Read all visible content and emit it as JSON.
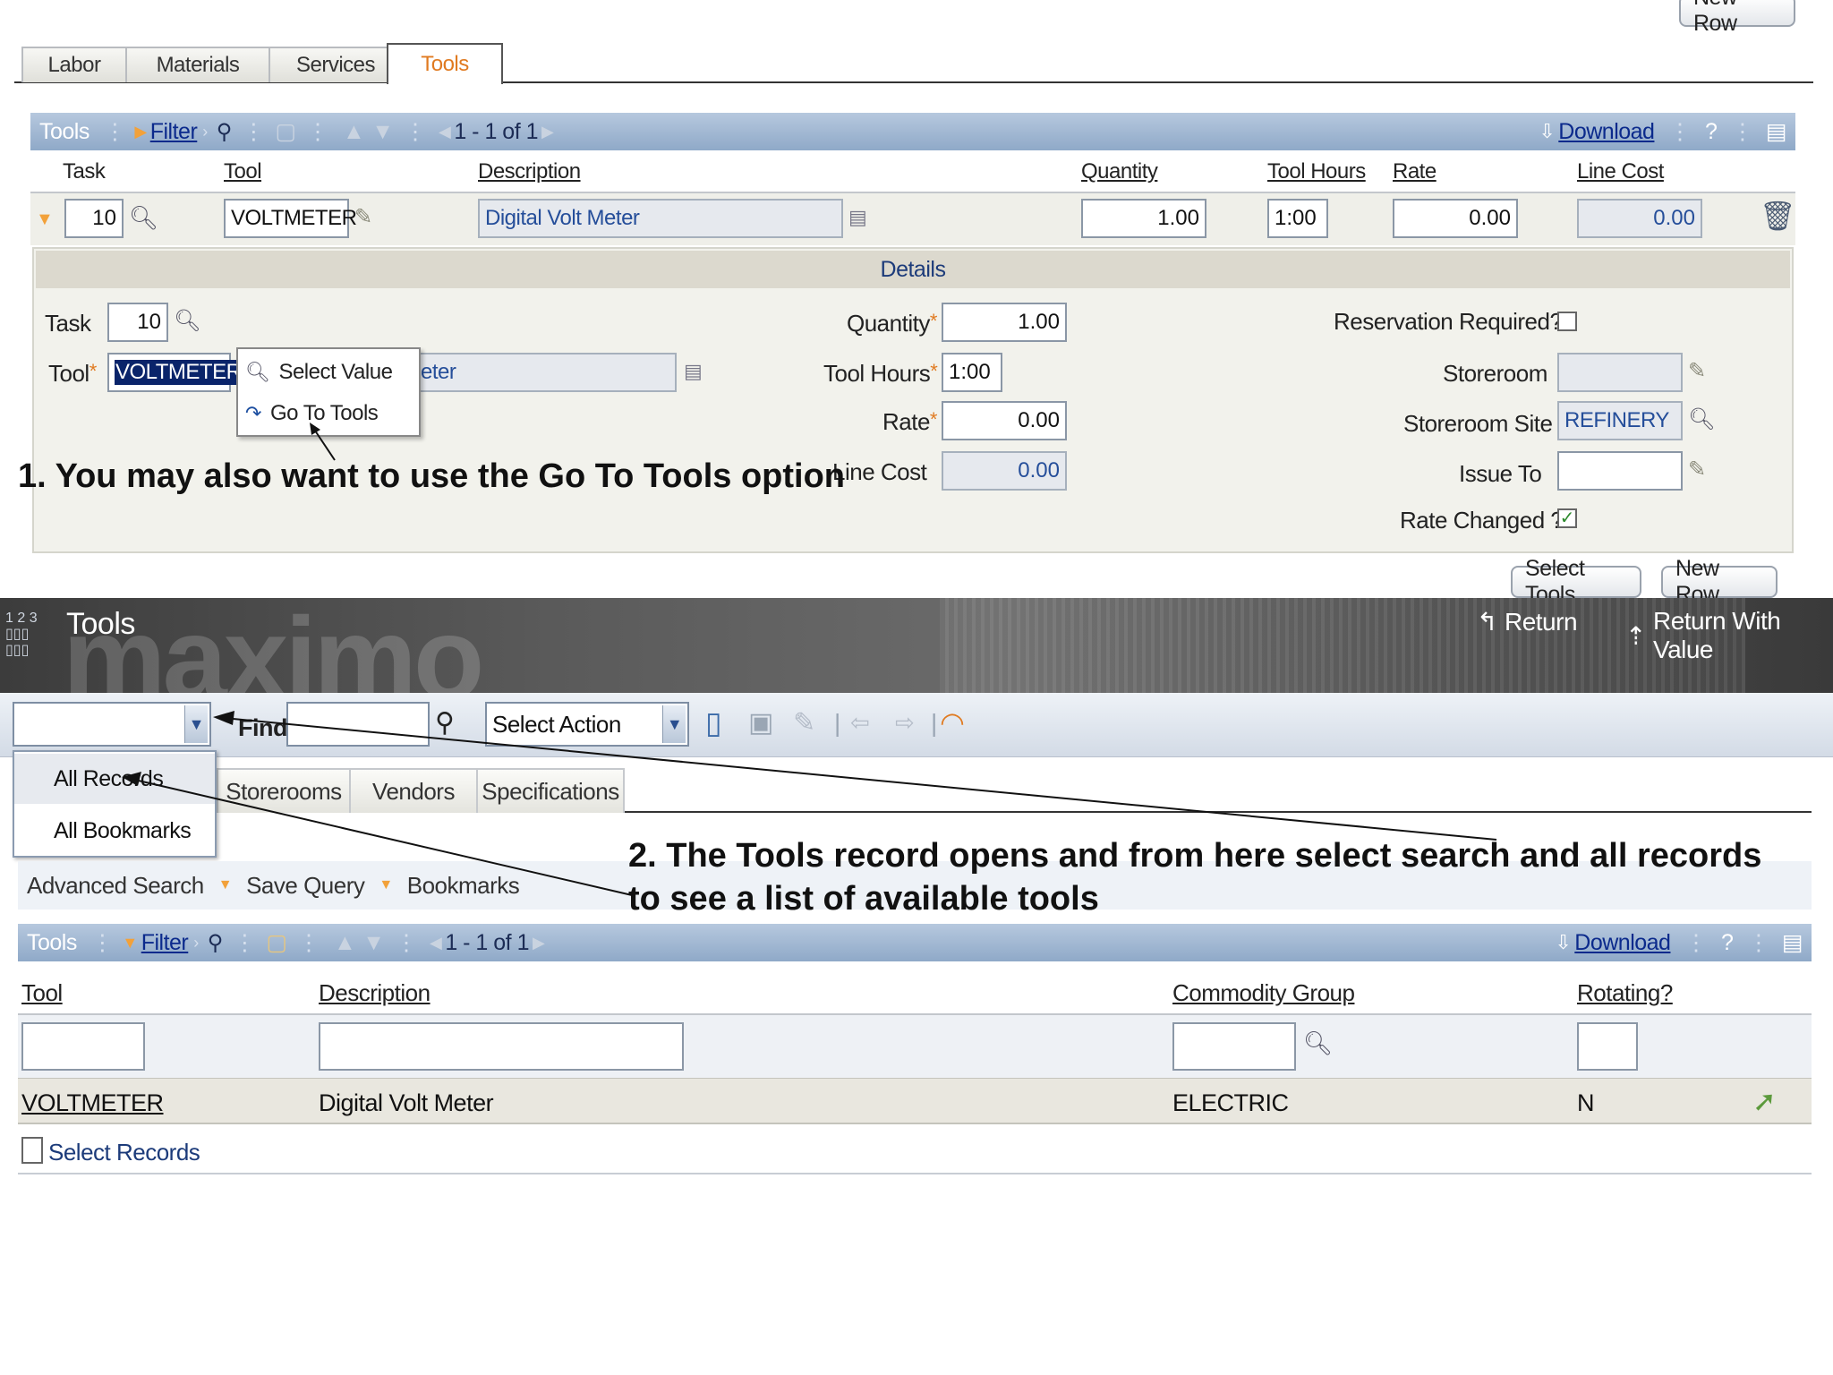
{
  "top": {
    "new_row_top": "New Row",
    "tabs": [
      "Labor",
      "Materials",
      "Services",
      "Tools"
    ],
    "bar": {
      "title": "Tools",
      "filter": "Filter",
      "paging": "1 - 1 of 1",
      "download": "Download",
      "help": "?"
    },
    "columns": [
      "Task",
      "Tool",
      "Description",
      "Quantity",
      "Tool Hours",
      "Rate",
      "Line Cost"
    ],
    "row": {
      "task": "10",
      "tool": "VOLTMETER",
      "description": "Digital Volt Meter",
      "quantity": "1.00",
      "tool_hours": "1:00",
      "rate": "0.00",
      "line_cost": "0.00"
    },
    "details": {
      "heading": "Details",
      "task_label": "Task",
      "task_value": "10",
      "tool_label": "Tool",
      "tool_value": "VOLTMETER",
      "desc_partial": "eter",
      "quantity_label": "Quantity",
      "quantity_value": "1.00",
      "tool_hours_label": "Tool Hours",
      "tool_hours_value": "1:00",
      "rate_label": "Rate",
      "rate_value": "0.00",
      "line_cost_label": "Line Cost",
      "line_cost_value": "0.00",
      "reservation_label": "Reservation Required?",
      "storeroom_label": "Storeroom",
      "storeroom_site_label": "Storeroom Site",
      "storeroom_site_value": "REFINERY",
      "issue_to_label": "Issue To",
      "rate_changed_label": "Rate Changed ?",
      "rate_changed_checked": true,
      "reservation_checked": false
    },
    "context_menu": [
      "Select Value",
      "Go To Tools"
    ],
    "select_tools_button": "Select Tools",
    "new_row_bottom": "New Row"
  },
  "annotations": {
    "step1": "1. You may also want to use the Go To Tools option",
    "step2": "2. The Tools record opens and from here select search and all records to see a list of available tools"
  },
  "maximo": {
    "title": "Tools",
    "logo_text": "maximo",
    "return_label": "Return",
    "return_value_label": "Return With Value",
    "find_label": "Find:",
    "select_action": "Select Action",
    "dropdown": [
      "All Records",
      "All Bookmarks"
    ],
    "tabs": [
      "Storerooms",
      "Vendors",
      "Specifications"
    ],
    "search_links": [
      "Advanced Search",
      "Save Query",
      "Bookmarks"
    ],
    "bar": {
      "title": "Tools",
      "filter": "Filter",
      "paging": "1 - 1 of 1",
      "download": "Download",
      "help": "?"
    },
    "columns": [
      "Tool",
      "Description",
      "Commodity Group",
      "Rotating?"
    ],
    "rows": [
      {
        "tool": "VOLTMETER",
        "description": "Digital Volt Meter",
        "commodity_group": "ELECTRIC",
        "rotating": "N"
      }
    ],
    "select_records": "Select Records"
  },
  "colors": {
    "bar_blue": "#9fb6d2",
    "accent_orange": "#e07a20",
    "link_blue": "#0b2a8c"
  }
}
